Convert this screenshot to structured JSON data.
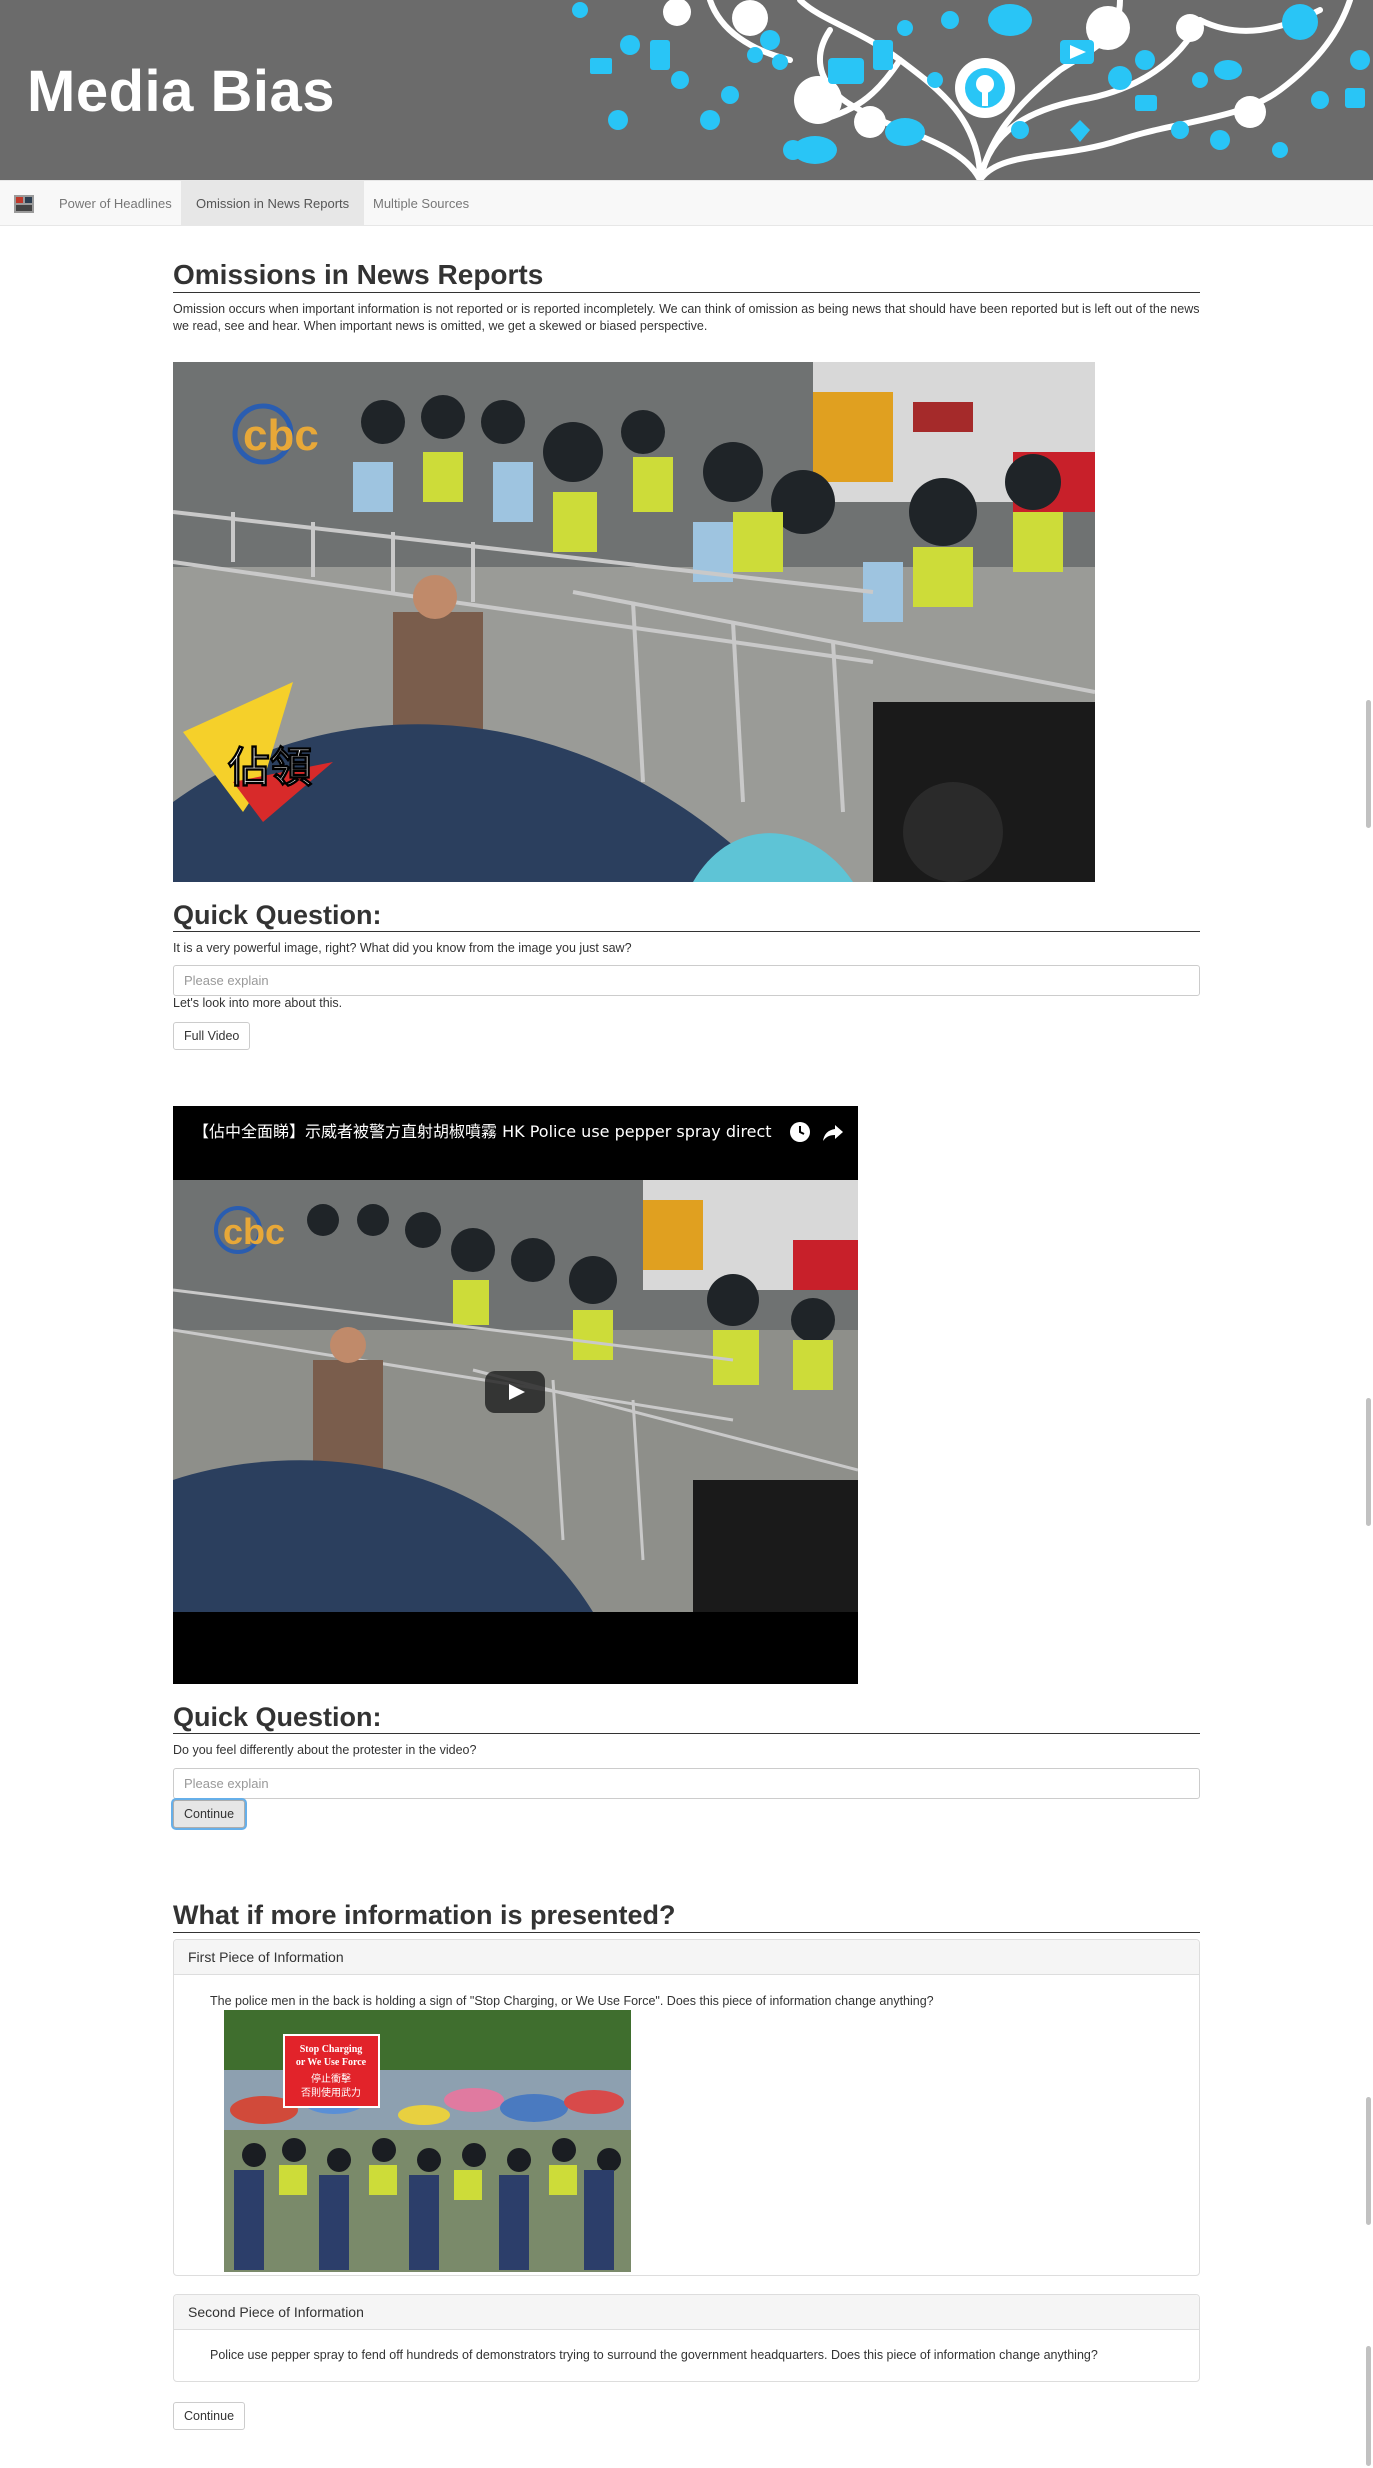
{
  "banner": {
    "title": "Media Bias"
  },
  "nav": {
    "items": [
      {
        "label": "Power of Headlines",
        "active": false
      },
      {
        "label": "Omission in News Reports",
        "active": true
      },
      {
        "label": "Multiple Sources",
        "active": false
      }
    ]
  },
  "omissions": {
    "heading": "Omissions in News Reports",
    "intro": "Omission occurs when important information is not reported or is reported incompletely. We can think of omission as being news that should have been reported but is left out of the news we read, see and hear. When important news is omitted, we get a skewed or biased perspective.",
    "image_overlay_text": "佔領"
  },
  "question1": {
    "heading": "Quick Question:",
    "prompt": "It is a very powerful image, right? What did you know from the image you just saw?",
    "placeholder": "Please explain",
    "followup": "Let's look into more about this.",
    "button": "Full Video"
  },
  "video": {
    "title": "【佔中全面睇】示威者被警方直射胡椒噴霧 HK Police use pepper spray directly on ...",
    "icons": [
      "clock-icon",
      "share-icon",
      "play-icon"
    ]
  },
  "question2": {
    "heading": "Quick Question:",
    "prompt": "Do you feel differently about the protester in the video?",
    "placeholder": "Please explain",
    "button": "Continue"
  },
  "more_info": {
    "heading": "What if more information is presented?",
    "panels": [
      {
        "title": "First Piece of Information",
        "text": "The police men in the back is holding a sign of \"Stop Charging, or We Use Force\". Does this piece of information change anything?",
        "sign_line1": "Stop Charging",
        "sign_line2": "or We Use Force",
        "sign_line3": "停止衝擊",
        "sign_line4": "否則使用武力"
      },
      {
        "title": "Second Piece of Information",
        "text": "Police use pepper spray to fend off hundreds of demonstrators trying to surround the government headquarters. Does this piece of information change anything?"
      }
    ],
    "button": "Continue"
  },
  "colors": {
    "banner_bg": "#6b6b6b",
    "banner_icons": "#29c5f6",
    "navbar_bg": "#f8f8f8",
    "nav_active_bg": "#e7e7e7",
    "sign_red": "#e2232a"
  }
}
